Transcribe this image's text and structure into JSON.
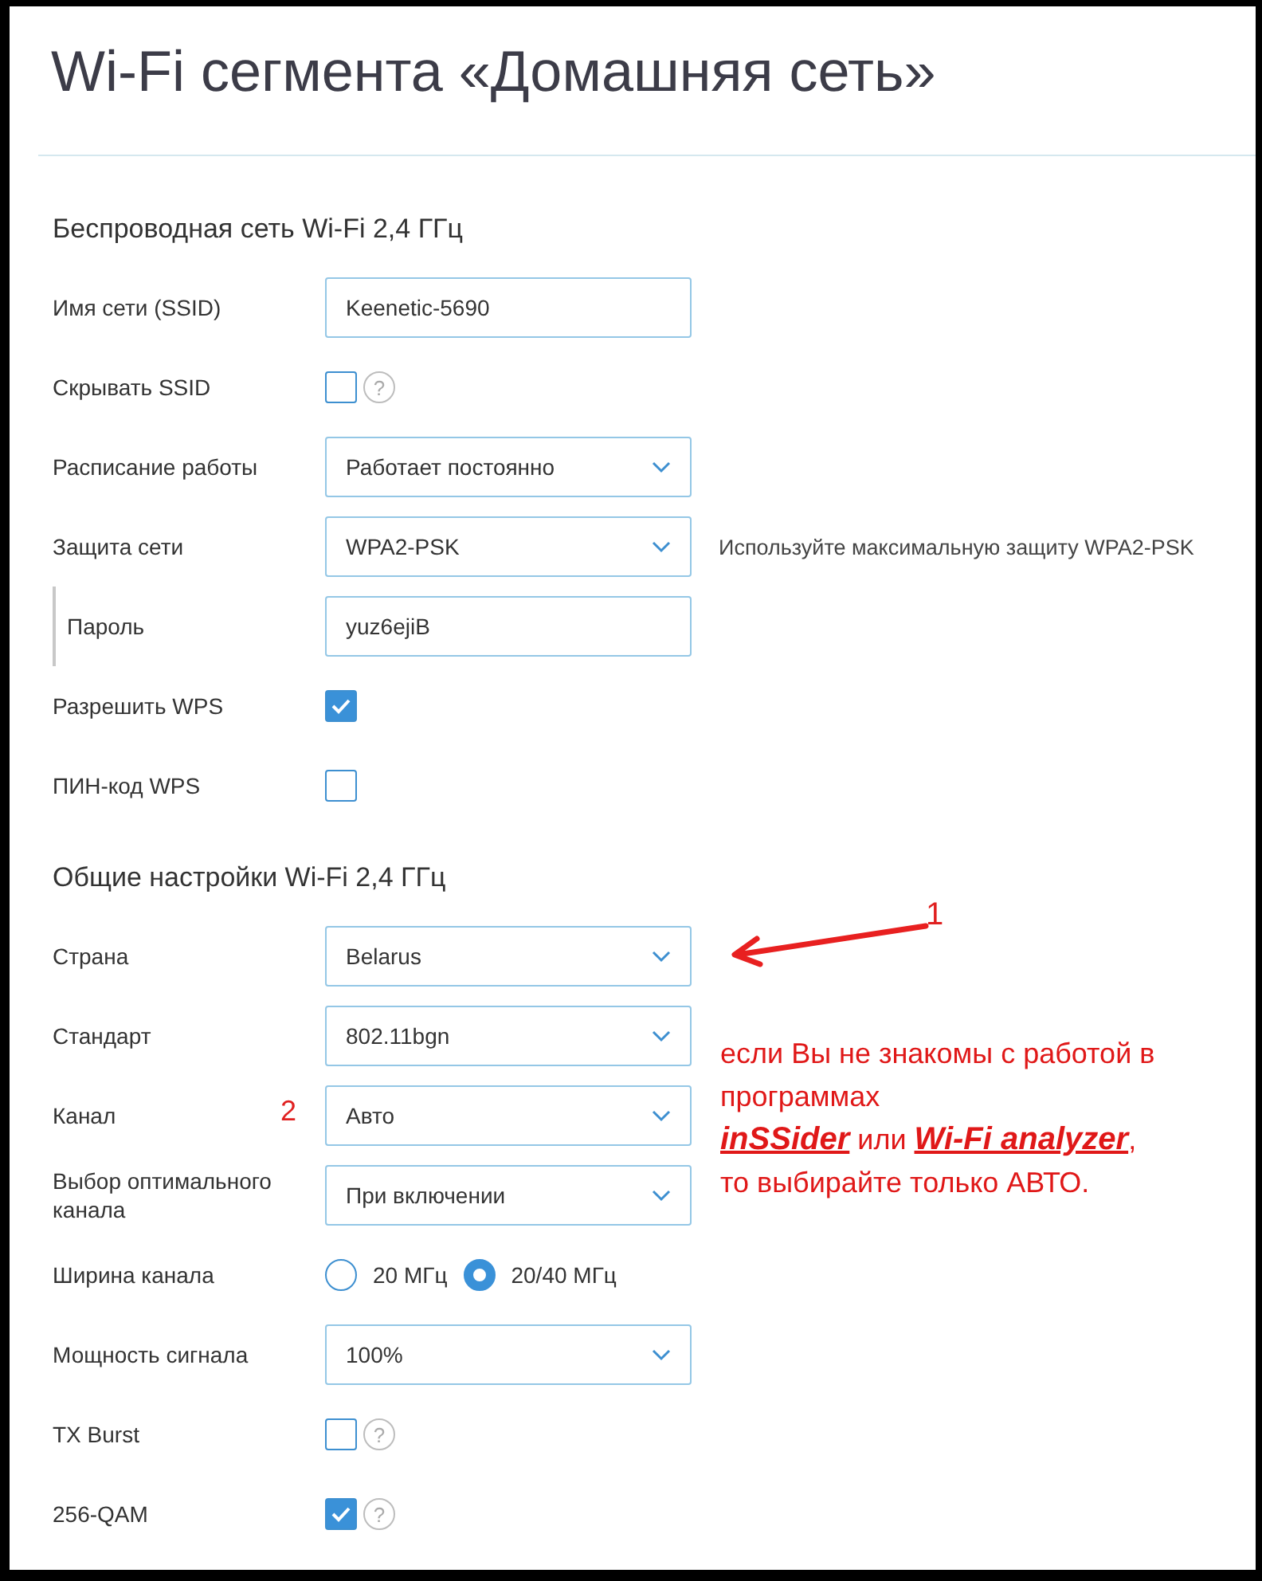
{
  "page": {
    "title": "Wi-Fi сегмента «Домашняя сеть»"
  },
  "sections": [
    {
      "heading": "Беспроводная сеть Wi-Fi 2,4 ГГц",
      "rows": [
        {
          "kind": "text",
          "label": "Имя сети (SSID)",
          "value": "Keenetic-5690"
        },
        {
          "kind": "checkbox",
          "label": "Скрывать SSID",
          "checked": false,
          "help": "?"
        },
        {
          "kind": "select",
          "label": "Расписание работы",
          "value": "Работает постоянно"
        },
        {
          "kind": "select",
          "label": "Защита сети",
          "value": "WPA2-PSK",
          "hint": "Используйте максимальную защиту WPA2-PSK"
        },
        {
          "kind": "text",
          "label": "Пароль",
          "value": "yuz6ejiB",
          "indented": true
        },
        {
          "kind": "checkbox",
          "label": "Разрешить WPS",
          "checked": true
        },
        {
          "kind": "checkbox",
          "label": "ПИН-код WPS",
          "checked": false
        }
      ]
    },
    {
      "heading": "Общие настройки Wi-Fi 2,4 ГГц",
      "rows": [
        {
          "kind": "select",
          "label": "Страна",
          "value": "Belarus",
          "callout": "1"
        },
        {
          "kind": "select",
          "label": "Стандарт",
          "value": "802.11bgn"
        },
        {
          "kind": "select",
          "label": "Канал",
          "value": "Авто",
          "marker": "2"
        },
        {
          "kind": "select",
          "label": "Выбор оптимального канала",
          "value": "При включении"
        },
        {
          "kind": "radio",
          "label": "Ширина канала",
          "options": [
            {
              "label": "20 МГц",
              "selected": false
            },
            {
              "label": "20/40 МГц",
              "selected": true
            }
          ]
        },
        {
          "kind": "select",
          "label": "Мощность сигнала",
          "value": "100%"
        },
        {
          "kind": "checkbox",
          "label": "TX Burst",
          "checked": false,
          "help": "?"
        },
        {
          "kind": "checkbox",
          "label": "256-QAM",
          "checked": true,
          "help": "?"
        }
      ],
      "note": [
        "если Вы не знакомы с работой в",
        "программах",
        "*inSSider* или *Wi-Fi analyzer*,",
        "то выбирайте только АВТО."
      ]
    }
  ]
}
